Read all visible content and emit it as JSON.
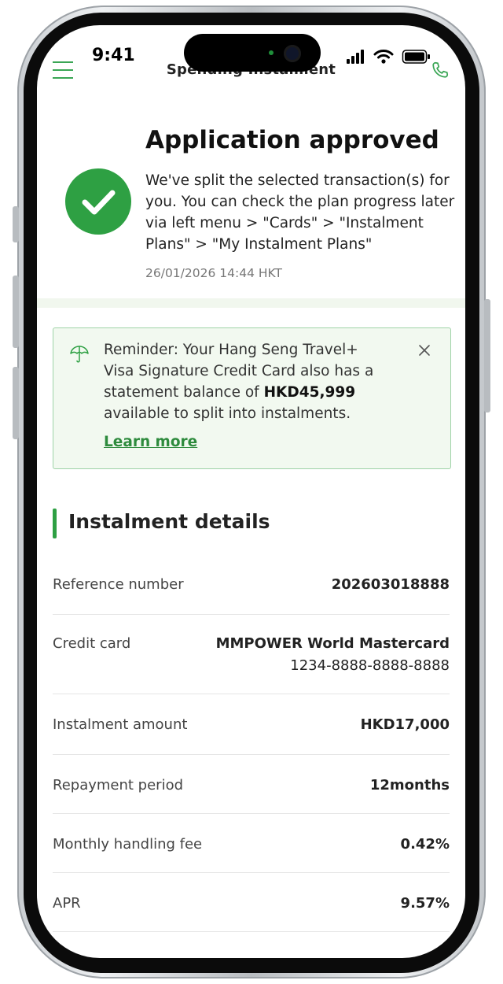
{
  "status_bar": {
    "time": "9:41"
  },
  "app_bar": {
    "title": "Spending Instalment"
  },
  "approval": {
    "title": "Application approved",
    "message": "We've split the selected transaction(s) for you. You can check the plan progress later via left menu > \"Cards\" > \"Instalment Plans\" > \"My Instalment Plans\"",
    "timestamp": "26/01/2026 14:44 HKT"
  },
  "reminder": {
    "text_before": "Reminder: Your Hang Seng Travel+ Visa Signature Credit Card also has a statement balance of ",
    "amount": "HKD45,999",
    "text_after": " available to split into instalments.",
    "link": "Learn more"
  },
  "details": {
    "section_title": "Instalment details",
    "rows": [
      {
        "label": "Reference number",
        "value": "202603018888"
      },
      {
        "label": "Credit card",
        "value": "MMPOWER World Mastercard",
        "sub_value": "1234-8888-8888-8888"
      },
      {
        "label": "Instalment amount",
        "value": "HKD17,000"
      },
      {
        "label": "Repayment period",
        "value": "12months"
      },
      {
        "label": "Monthly handling fee",
        "value": "0.42%"
      },
      {
        "label": "APR",
        "value": "9.57%"
      }
    ]
  },
  "colors": {
    "accent": "#2ea043",
    "reminder_bg": "#f2f9f0",
    "reminder_border": "#9fd3a7",
    "link": "#2e8b3d"
  }
}
